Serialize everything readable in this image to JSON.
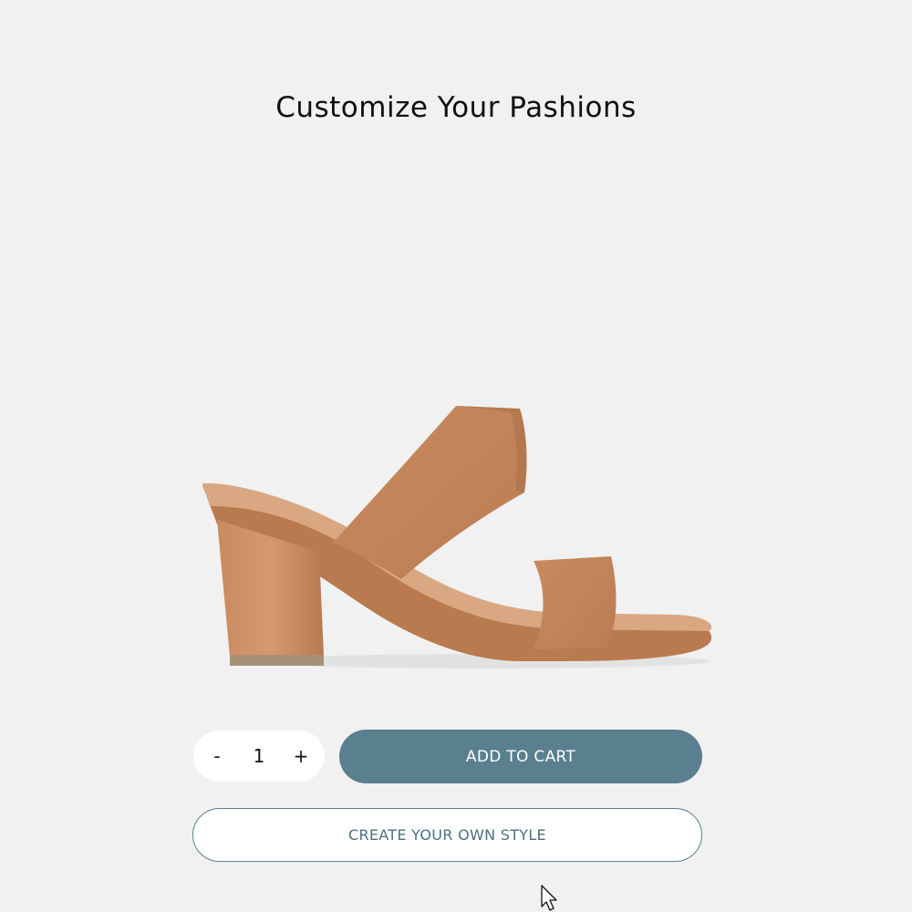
{
  "page": {
    "title": "Customize Your Pashions"
  },
  "product": {
    "image_icon": "sandal-image",
    "color": "#c3835a"
  },
  "quantity": {
    "decrement_label": "-",
    "value": "1",
    "increment_label": "+"
  },
  "actions": {
    "add_to_cart_label": "ADD TO CART",
    "create_style_label": "CREATE YOUR OWN STYLE"
  },
  "colors": {
    "accent": "#5a7f8f",
    "background": "#f1f1f1"
  }
}
